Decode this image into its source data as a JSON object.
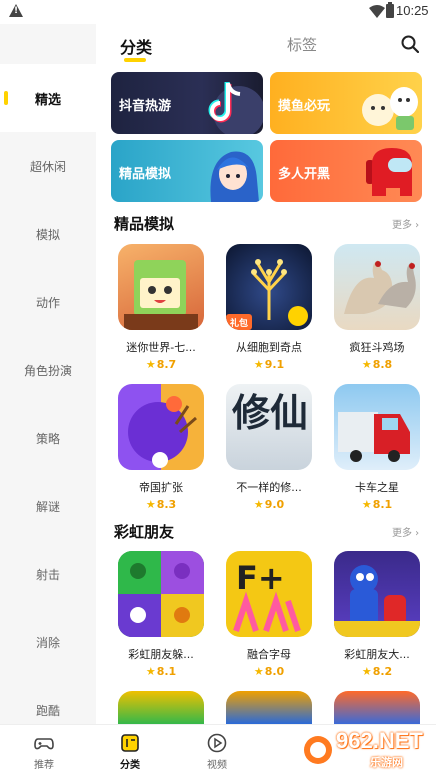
{
  "status_bar": {
    "time": "10:25"
  },
  "sidebar": {
    "items": [
      {
        "label": "精选",
        "active": true
      },
      {
        "label": "超休闲"
      },
      {
        "label": "模拟"
      },
      {
        "label": "动作"
      },
      {
        "label": "角色扮演"
      },
      {
        "label": "策略"
      },
      {
        "label": "解谜"
      },
      {
        "label": "射击"
      },
      {
        "label": "消除"
      },
      {
        "label": "跑酷"
      }
    ]
  },
  "header": {
    "tabs": [
      "分类",
      "标签"
    ],
    "active_tab": "分类"
  },
  "banners": [
    "抖音热游",
    "摸鱼必玩",
    "精品模拟",
    "多人开黑"
  ],
  "sections": [
    {
      "title": "精品模拟",
      "more": "更多",
      "games": [
        {
          "name": "迷你世界-七...",
          "rating": "8.7"
        },
        {
          "name": "从细胞到奇点",
          "rating": "9.1",
          "badge": "礼包"
        },
        {
          "name": "疯狂斗鸡场",
          "rating": "8.8"
        },
        {
          "name": "帝国扩张",
          "rating": "8.3"
        },
        {
          "name": "不一样的修...",
          "rating": "9.0",
          "icon_text": "修仙"
        },
        {
          "name": "卡车之星",
          "rating": "8.1"
        }
      ]
    },
    {
      "title": "彩虹朋友",
      "more": "更多",
      "games": [
        {
          "name": "彩虹朋友躲...",
          "rating": "8.1"
        },
        {
          "name": "融合字母",
          "rating": "8.0",
          "icon_text": "F+"
        },
        {
          "name": "彩虹朋友大...",
          "rating": "8.2"
        }
      ]
    }
  ],
  "bottom_nav": [
    {
      "label": "推荐",
      "icon": "gamepad-icon"
    },
    {
      "label": "分类",
      "icon": "category-icon",
      "active": true
    },
    {
      "label": "视频",
      "icon": "play-icon"
    }
  ],
  "watermark": {
    "text": "962.NET",
    "sub": "乐游网"
  },
  "colors": {
    "accent": "#ffd200",
    "rating": "#f0a000"
  }
}
